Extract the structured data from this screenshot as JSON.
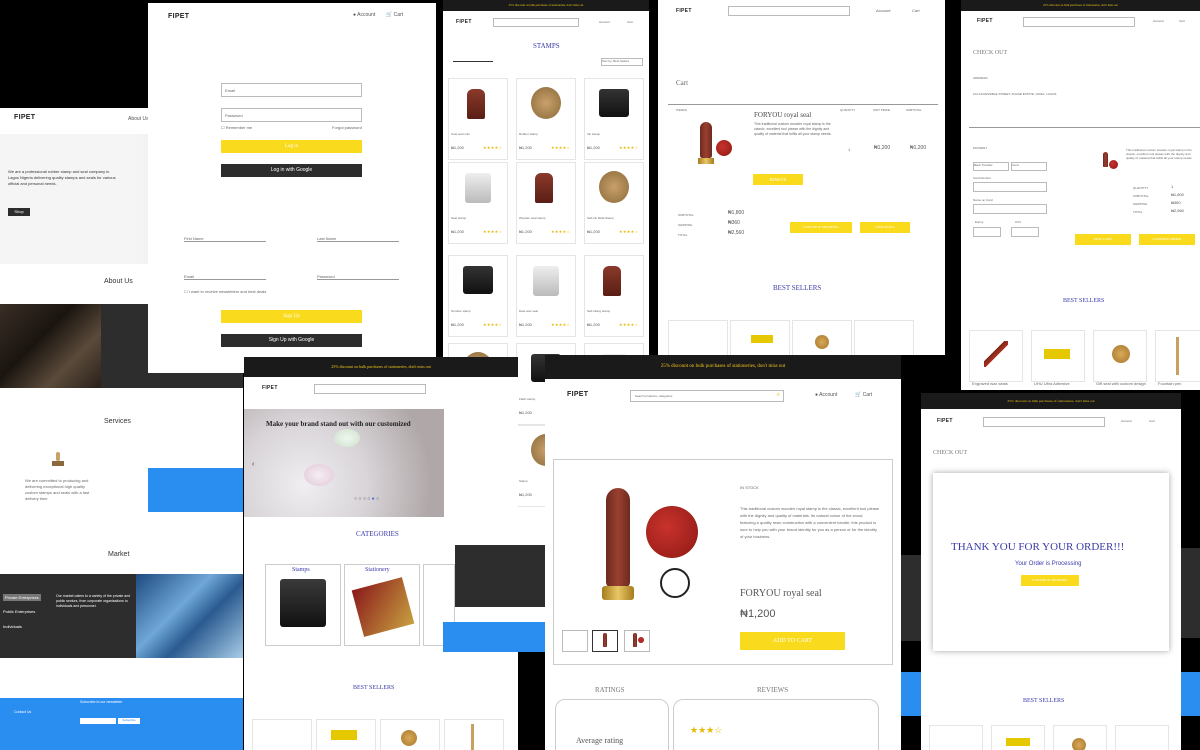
{
  "brand": "FIPET",
  "promo": "25% discount on bulk purchases of stationeries, don't miss out",
  "nav": {
    "account": "Account",
    "cart": "Cart",
    "search_placeholder": "Search products, categories",
    "about": "About Us"
  },
  "login": {
    "email": "Email",
    "password": "Password",
    "remember": "Remember me",
    "forgot": "Forgot password",
    "login_btn": "Log in",
    "google_btn": "Log in with Google"
  },
  "signup": {
    "first_name": "First Name",
    "last_name": "Last Name",
    "email": "Email",
    "password": "Password",
    "newsletter": "I want to receive newsletters and best deals",
    "signup_btn": "Sign Up",
    "google_btn": "Sign Up with Google"
  },
  "about_page": {
    "hero_text": "We are a professional rubber stamp and seal company in Lagos Nigeria delivering quality stamps and seals for various official and personal needs.",
    "hero_btn": "Shop",
    "about_title": "About Us",
    "services_title": "Services",
    "services_text": "We are committed to producing and delivering exceptional high quality custom stamps and seals with a fast delivery time",
    "market_title": "Market",
    "market_items": [
      "Private Enterprises",
      "Public Enterprises",
      "Individuals"
    ],
    "market_text": "Our market caters to a variety of the private and public sectors, from corporate organisations to individuals and personnel."
  },
  "stamps_page": {
    "title": "STAMPS",
    "sort_label": "Sort by: Best Sellers",
    "products": [
      {
        "name": "Cast seal mini",
        "price": "₦1,200"
      },
      {
        "name": "Rubber stamp",
        "price": "₦1,200"
      },
      {
        "name": "Ink stamp",
        "price": "₦1,200"
      },
      {
        "name": "Seal stamp",
        "price": "₦1,200"
      },
      {
        "name": "Wooden seal stamp",
        "price": "₦1,200"
      },
      {
        "name": "Self-ink Multi-Stamp",
        "price": "₦1,200"
      },
      {
        "name": "Number stamp",
        "price": "₦1,200"
      },
      {
        "name": "Date wax seal",
        "price": "₦1,200"
      },
      {
        "name": "Self-inking stamp",
        "price": "₦1,200"
      },
      {
        "name": "Wooden seal",
        "price": "₦1,200"
      },
      {
        "name": "Flash stamp",
        "price": "₦1,200"
      },
      {
        "name": "Pocket stamp",
        "price": "₦1,200"
      },
      {
        "name": "Date stamp",
        "price": "₦1,200"
      },
      {
        "name": "Stamp",
        "price": "₦1,200"
      }
    ]
  },
  "cart_page": {
    "title": "Cart",
    "headers": [
      "ITEM(S)",
      "QUANTITY",
      "UNIT PRICE",
      "SUBTOTAL"
    ],
    "item_name": "FORYOU royal seal",
    "item_desc": "This traditional custom wooden royal stamp is the classic, excellent tool please with the dignity and quality of material that fulfils all your stamp needs.",
    "quantity": "1",
    "unit_price": "₦1,200",
    "subtotal": "₦1,200",
    "remove_btn": "REMOVE",
    "summary_labels": [
      "SUBTOTAL",
      "SHIPPING",
      "TOTAL"
    ],
    "summary_values": [
      "₦1,800",
      "₦360",
      "₦2,560"
    ],
    "continue_btn": "CONTINUE SHOPPING",
    "checkout_btn": "CHECKOUT",
    "best_sellers": "BEST SELLERS"
  },
  "checkout_page": {
    "title": "CHECK OUT",
    "address_label": "ADDRESS",
    "address_value": "10A ACCESSIBLE STREET, PHASE ESTATE, OSIFA, LAGOS",
    "payment_label": "PAYMENT",
    "pay_options": [
      "Bank Transfer",
      "Card"
    ],
    "card_number": "Card Number",
    "card_name": "Name on Card",
    "expiry": "Expiry",
    "cvv": "CVV",
    "summary_labels": [
      "QUANTITY",
      "SUBTOTAL",
      "SHIPPING",
      "TOTAL"
    ],
    "summary_values": [
      "1",
      "₦1,800",
      "₦360",
      "₦2,560"
    ],
    "edit_btn": "EDIT CART",
    "confirm_btn": "CONFIRM ORDER",
    "best_sellers": "BEST SELLERS",
    "best_items": [
      "Engraved wax seals",
      "UHU Ultra Adhesive",
      "Gift seal with custom design",
      "Fountain pen"
    ]
  },
  "home_page": {
    "hero_text": "Make your brand stand out with our customized",
    "categories_title": "CATEGORIES",
    "categories": [
      "Stamps",
      "Stationery"
    ],
    "best_sellers": "BEST SELLERS"
  },
  "product_page": {
    "status": "IN STOCK",
    "desc": "This traditional custom wooden royal stamp is the classic, excellent tool please with the dignity and quality of materials. Its natural colour of the wood, featuring a quality resin construction with a convenient handle, this product is sure to help you with your brand identity for you as a person or for the identity of your business.",
    "name": "FORYOU royal seal",
    "price": "₦1,200",
    "add_btn": "ADD TO CART",
    "tabs": [
      "RATINGS",
      "REVIEWS"
    ],
    "avg_rating": "Average rating"
  },
  "thanks_page": {
    "title": "CHECK OUT",
    "heading": "THANK YOU FOR YOUR ORDER!!!",
    "sub": "Your Order is Processing",
    "btn": "CONTINUE SHOPPING",
    "best_sellers": "BEST SELLERS"
  },
  "footer": {
    "newsletter": "Subscribe to our newsletter",
    "subscribe_btn": "Subscribe",
    "contact": "Contact Us"
  },
  "colors": {
    "accent": "#f9da1c",
    "dark": "#2d2d2d",
    "blue": "#2a8df0",
    "title_blue": "#3a3aa8"
  }
}
